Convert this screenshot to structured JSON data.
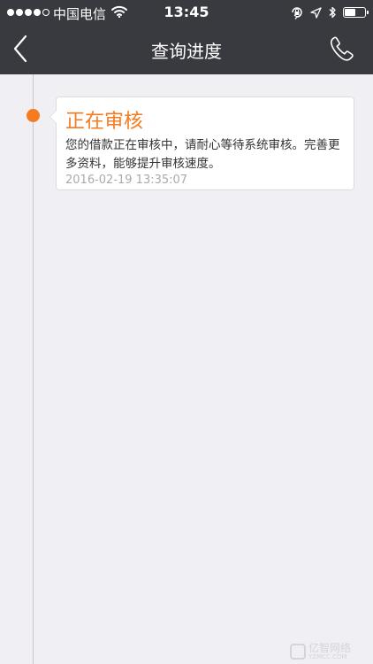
{
  "status_bar": {
    "signal_filled": 4,
    "signal_total": 5,
    "carrier": "中国电信",
    "time": "13:45",
    "battery_level": 0.55
  },
  "nav": {
    "title": "查询进度",
    "back_icon": "chevron-left-icon",
    "phone_icon": "phone-icon"
  },
  "progress": {
    "status_title": "正在审核",
    "description": "您的借款正在审核中，请耐心等待系统审核。完善更多资料，能够提升审核速度。",
    "timestamp": "2016-02-19 13:35:07",
    "accent_color": "#f47b20"
  },
  "watermark": {
    "text": "亿智网络",
    "subtext": "YZMCC.COM"
  }
}
